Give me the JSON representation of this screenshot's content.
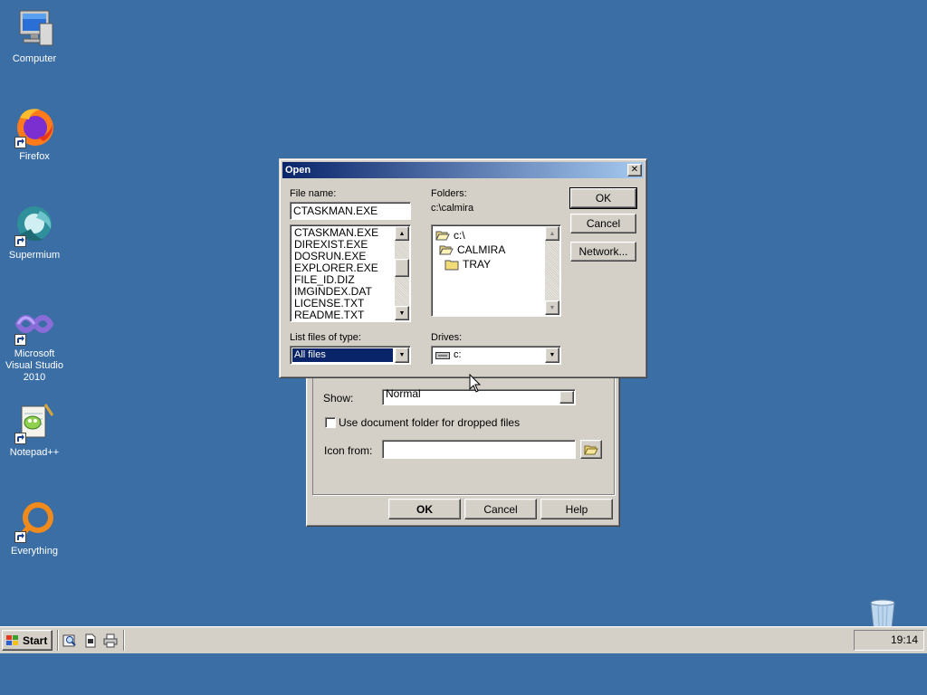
{
  "desktop": {
    "icons": [
      {
        "name": "computer",
        "label": "Computer",
        "icon": "computer-icon"
      },
      {
        "name": "firefox",
        "label": "Firefox",
        "icon": "firefox-icon"
      },
      {
        "name": "supermium",
        "label": "Supermium",
        "icon": "supermium-icon"
      },
      {
        "name": "vs2010",
        "label": "Microsoft Visual Studio 2010",
        "icon": "visual-studio-icon"
      },
      {
        "name": "notepadpp",
        "label": "Notepad++",
        "icon": "notepadpp-icon"
      },
      {
        "name": "everything",
        "label": "Everything",
        "icon": "everything-icon"
      },
      {
        "name": "recycle-bin",
        "label": "",
        "icon": "recycle-bin-icon"
      }
    ],
    "background_color": "#3a6ea5"
  },
  "background_dialog": {
    "show_label": "Show:",
    "show_value": "Normal",
    "use_doc_folder_label": "Use document folder for dropped files",
    "use_doc_folder_checked": false,
    "icon_from_label": "Icon from:",
    "icon_from_value": "",
    "buttons": {
      "ok": "OK",
      "cancel": "Cancel",
      "help": "Help"
    }
  },
  "open_dialog": {
    "title": "Open",
    "close_glyph": "✕",
    "file_name_label": "File name:",
    "file_name_value": "CTASKMAN.EXE",
    "files": [
      "CTASKMAN.EXE",
      "DIREXIST.EXE",
      "DOSRUN.EXE",
      "EXPLORER.EXE",
      "FILE_ID.DIZ",
      "IMGINDEX.DAT",
      "LICENSE.TXT",
      "README.TXT"
    ],
    "folders_label": "Folders:",
    "current_folder": "c:\\calmira",
    "folder_tree": [
      "c:\\",
      "CALMIRA",
      "TRAY"
    ],
    "list_type_label": "List files of type:",
    "list_type_value": "All files",
    "drives_label": "Drives:",
    "drives_value": "c:",
    "buttons": {
      "ok": "OK",
      "cancel": "Cancel",
      "network": "Network..."
    }
  },
  "taskbar": {
    "start_label": "Start",
    "clock": "19:14",
    "quick_launch": [
      "search-files-icon",
      "document-icon",
      "printer-icon"
    ]
  }
}
